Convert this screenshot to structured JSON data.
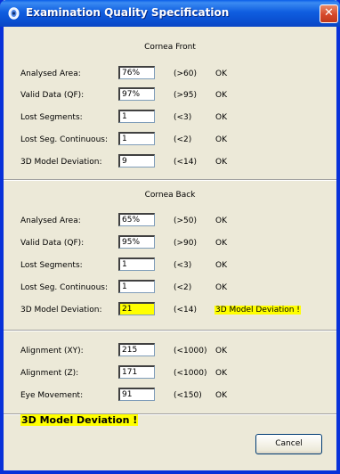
{
  "window": {
    "title": "Examination Quality Specification"
  },
  "cornea_front": {
    "title": "Cornea Front",
    "rows": [
      {
        "label": "Analysed Area:",
        "value": "76%",
        "range": "(>60)",
        "status": "OK"
      },
      {
        "label": "Valid Data (QF):",
        "value": "97%",
        "range": "(>95)",
        "status": "OK"
      },
      {
        "label": "Lost Segments:",
        "value": "1",
        "range": "(<3)",
        "status": "OK"
      },
      {
        "label": "Lost Seg. Continuous:",
        "value": "1",
        "range": "(<2)",
        "status": "OK"
      },
      {
        "label": "3D Model Deviation:",
        "value": "9",
        "range": "(<14)",
        "status": "OK"
      }
    ]
  },
  "cornea_back": {
    "title": "Cornea Back",
    "rows": [
      {
        "label": "Analysed Area:",
        "value": "65%",
        "range": "(>50)",
        "status": "OK"
      },
      {
        "label": "Valid Data (QF):",
        "value": "95%",
        "range": "(>90)",
        "status": "OK"
      },
      {
        "label": "Lost Segments:",
        "value": "1",
        "range": "(<3)",
        "status": "OK"
      },
      {
        "label": "Lost Seg. Continuous:",
        "value": "1",
        "range": "(<2)",
        "status": "OK"
      },
      {
        "label": "3D Model Deviation:",
        "value": "21",
        "range": "(<14)",
        "status": "3D Model Deviation !"
      }
    ]
  },
  "alignment": {
    "rows": [
      {
        "label": "Alignment (XY):",
        "value": "215",
        "range": "(<1000)",
        "status": "OK"
      },
      {
        "label": "Alignment (Z):",
        "value": "171",
        "range": "(<1000)",
        "status": "OK"
      },
      {
        "label": "Eye Movement:",
        "value": "91",
        "range": "(<150)",
        "status": "OK"
      }
    ]
  },
  "footer": {
    "warning": "3D Model Deviation !",
    "cancel_label": "Cancel"
  },
  "colors": {
    "warning_highlight": "#ffff00",
    "title_bar": "#0a5ee8",
    "close_button": "#d6482a"
  },
  "icons": {
    "title": "eye-icon",
    "close": "close-icon"
  }
}
